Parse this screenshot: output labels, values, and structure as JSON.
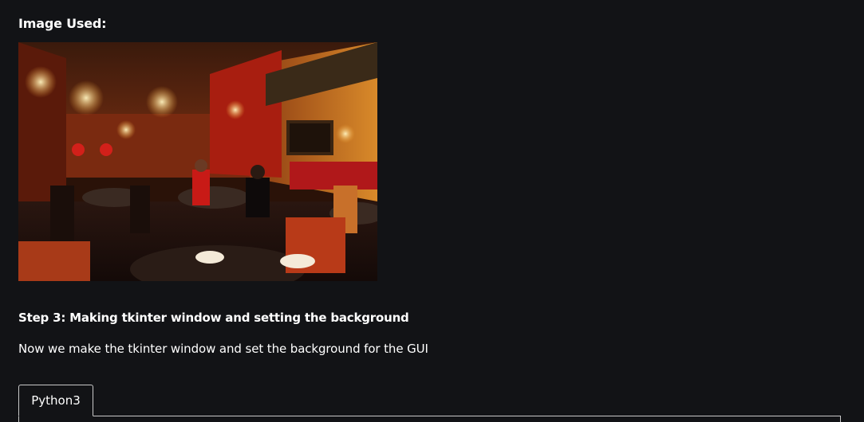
{
  "image_section": {
    "heading": "Image Used:"
  },
  "step": {
    "heading": "Step 3: Making tkinter window and setting the background",
    "description": "Now we make the tkinter window and set the background for the GUI"
  },
  "code_tabs": {
    "active_label": "Python3"
  },
  "colors": {
    "background": "#121316",
    "text": "#ffffff",
    "tab_border": "#c9c9c9"
  }
}
